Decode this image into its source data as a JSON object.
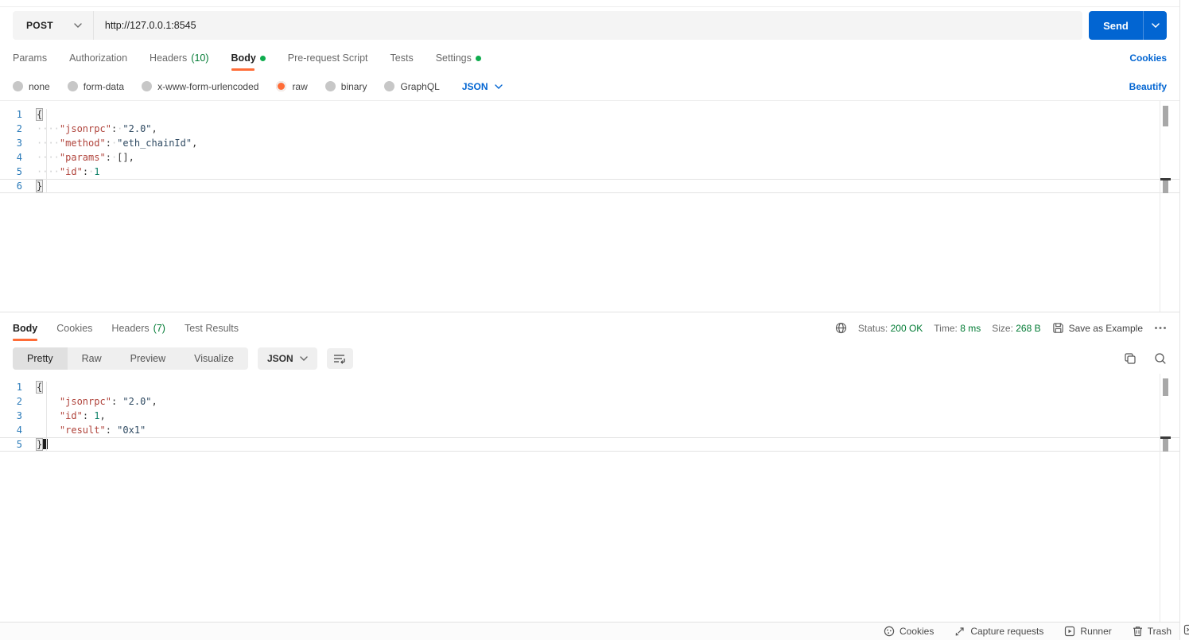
{
  "header": {
    "method": "POST",
    "url": "http://127.0.0.1:8545",
    "send_label": "Send"
  },
  "request_tabs": {
    "params": "Params",
    "authorization": "Authorization",
    "headers": "Headers",
    "headers_count": "(10)",
    "body": "Body",
    "prerequest": "Pre-request Script",
    "tests": "Tests",
    "settings": "Settings",
    "cookies_link": "Cookies"
  },
  "body_options": {
    "none": "none",
    "form_data": "form-data",
    "urlencoded": "x-www-form-urlencoded",
    "raw": "raw",
    "binary": "binary",
    "graphql": "GraphQL",
    "format": "JSON",
    "beautify_link": "Beautify"
  },
  "request_editor": {
    "lines": [
      {
        "num": "1",
        "tokens": [
          [
            "brace",
            "{"
          ]
        ]
      },
      {
        "num": "2",
        "tokens": [
          [
            "ws",
            "····"
          ],
          [
            "key",
            "\"jsonrpc\""
          ],
          [
            "p",
            ":"
          ],
          [
            "ws",
            "·"
          ],
          [
            "str",
            "\"2.0\""
          ],
          [
            "p",
            ","
          ]
        ]
      },
      {
        "num": "3",
        "tokens": [
          [
            "ws",
            "····"
          ],
          [
            "key",
            "\"method\""
          ],
          [
            "p",
            ":"
          ],
          [
            "ws",
            "·"
          ],
          [
            "str",
            "\"eth_chainId\""
          ],
          [
            "p",
            ","
          ]
        ]
      },
      {
        "num": "4",
        "tokens": [
          [
            "ws",
            "····"
          ],
          [
            "key",
            "\"params\""
          ],
          [
            "p",
            ":"
          ],
          [
            "ws",
            "·"
          ],
          [
            "p",
            "[],"
          ]
        ]
      },
      {
        "num": "5",
        "tokens": [
          [
            "ws",
            "····"
          ],
          [
            "key",
            "\"id\""
          ],
          [
            "p",
            ":"
          ],
          [
            "ws",
            "·"
          ],
          [
            "num",
            "1"
          ]
        ]
      },
      {
        "num": "6",
        "tokens": [
          [
            "brace",
            "}"
          ]
        ],
        "active": true
      }
    ]
  },
  "response_section": {
    "tabs": {
      "body": "Body",
      "cookies": "Cookies",
      "headers": "Headers",
      "headers_count": "(7)",
      "test_results": "Test Results"
    },
    "meta": {
      "status_label": "Status:",
      "status_value": "200 OK",
      "time_label": "Time:",
      "time_value": "8 ms",
      "size_label": "Size:",
      "size_value": "268 B",
      "save_as_example": "Save as Example"
    },
    "toolbar": {
      "pretty": "Pretty",
      "raw": "Raw",
      "preview": "Preview",
      "visualize": "Visualize",
      "format": "JSON"
    }
  },
  "response_editor": {
    "lines": [
      {
        "num": "1",
        "tokens": [
          [
            "brace",
            "{"
          ]
        ]
      },
      {
        "num": "2",
        "tokens": [
          [
            "sp",
            "    "
          ],
          [
            "key",
            "\"jsonrpc\""
          ],
          [
            "p",
            ": "
          ],
          [
            "str",
            "\"2.0\""
          ],
          [
            "p",
            ","
          ]
        ]
      },
      {
        "num": "3",
        "tokens": [
          [
            "sp",
            "    "
          ],
          [
            "key",
            "\"id\""
          ],
          [
            "p",
            ": "
          ],
          [
            "num",
            "1"
          ],
          [
            "p",
            ","
          ]
        ]
      },
      {
        "num": "4",
        "tokens": [
          [
            "sp",
            "    "
          ],
          [
            "key",
            "\"result\""
          ],
          [
            "p",
            ": "
          ],
          [
            "str",
            "\"0x1\""
          ]
        ]
      },
      {
        "num": "5",
        "tokens": [
          [
            "brace",
            "}"
          ]
        ],
        "active": true,
        "cursor": true
      }
    ]
  },
  "footer": {
    "cookies": "Cookies",
    "capture": "Capture requests",
    "runner": "Runner",
    "trash": "Trash"
  },
  "colors": {
    "accent_orange": "#ff6c37",
    "primary_blue": "#0265d2",
    "success_green": "#007a33",
    "dot_green": "#0fac4e"
  }
}
